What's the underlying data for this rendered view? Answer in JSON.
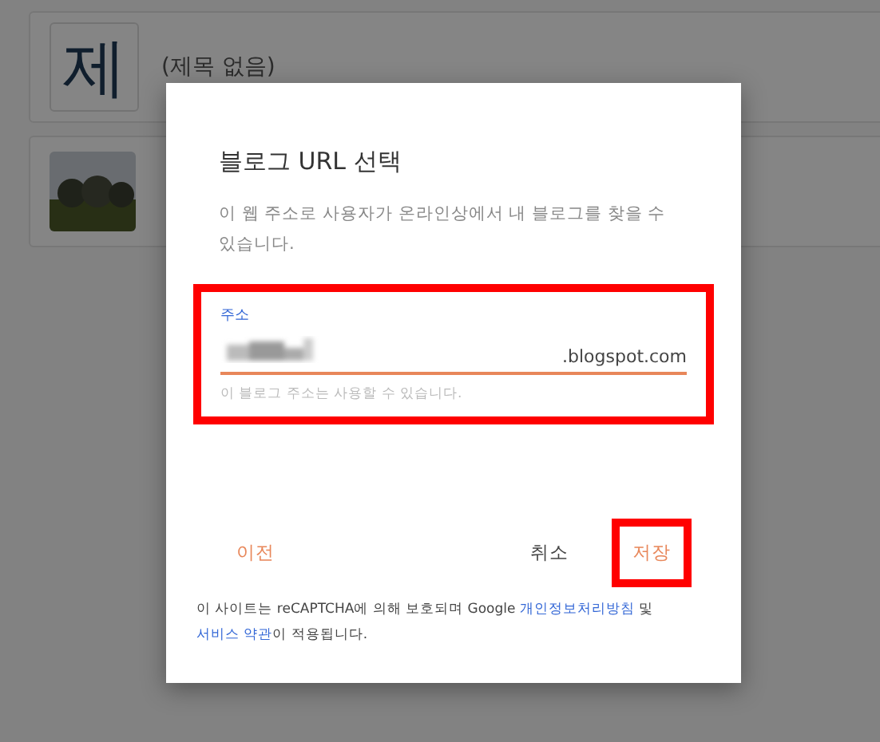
{
  "posts": [
    {
      "kind": "letter",
      "thumb_letter": "제",
      "title": "(제목 없음)"
    },
    {
      "kind": "picture"
    }
  ],
  "dialog": {
    "title": "블로그 URL 선택",
    "description": "이 웹 주소로 사용자가 온라인상에서 내 블로그를 찾을 수 있습니다.",
    "field": {
      "label": "주소",
      "suffix": ".blogspot.com",
      "helper": "이 블로그 주소는 사용할 수 있습니다.",
      "highlighted": true
    },
    "buttons": [
      {
        "kind": "back",
        "label": "이전",
        "highlighted": false
      },
      {
        "kind": "cancel",
        "label": "취소",
        "highlighted": false
      },
      {
        "kind": "save",
        "label": "저장",
        "highlighted": true
      }
    ],
    "footer": {
      "before": "이 사이트는 reCAPTCHA에 의해 보호되며 Google ",
      "link1": "개인정보처리방침",
      "middle": " 및 ",
      "link2": "서비스 약관",
      "after": "이 적용됩니다."
    }
  }
}
